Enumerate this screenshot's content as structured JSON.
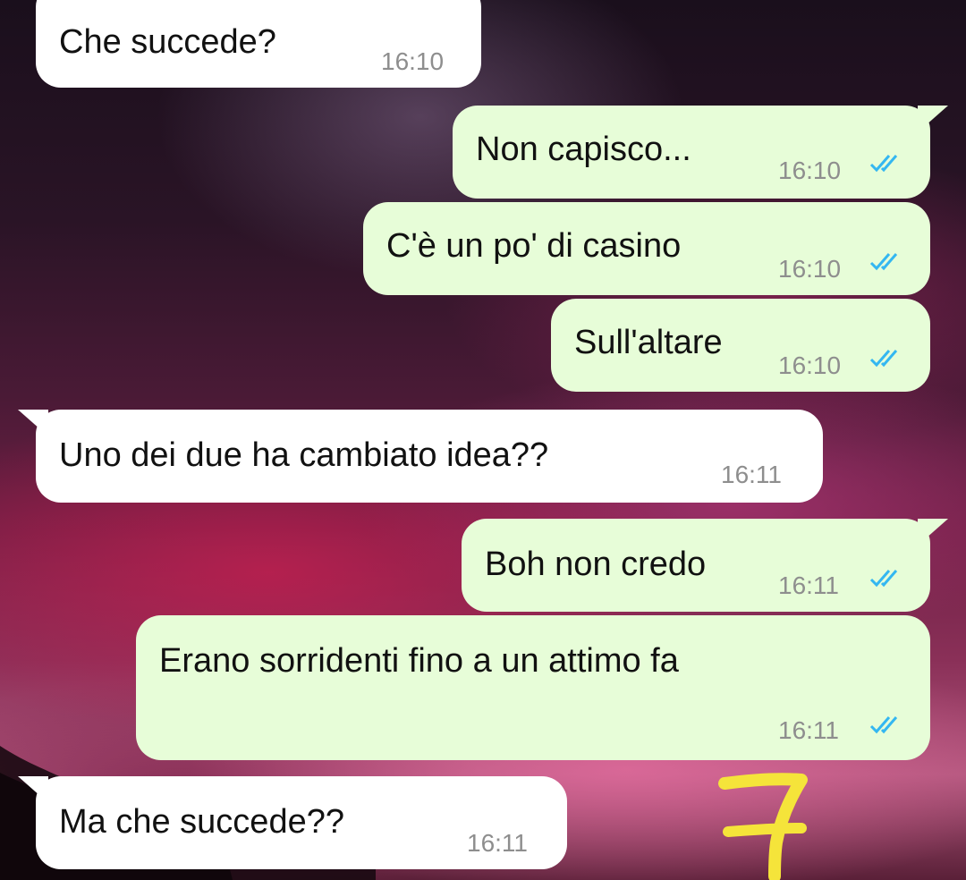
{
  "colors": {
    "incoming_bubble": "#ffffff",
    "outgoing_bubble": "#e7fdd8",
    "time_text": "#8e8e8e",
    "read_tick": "#34b7f1",
    "drawn_mark": "#f5e43a"
  },
  "messages": [
    {
      "direction": "incoming",
      "text": "Che succede?",
      "time": "16:10"
    },
    {
      "direction": "outgoing",
      "text": "Non capisco...",
      "time": "16:10",
      "status": "read"
    },
    {
      "direction": "outgoing",
      "text": "C'è un po' di casino",
      "time": "16:10",
      "status": "read"
    },
    {
      "direction": "outgoing",
      "text": "Sull'altare",
      "time": "16:10",
      "status": "read"
    },
    {
      "direction": "incoming",
      "text": "Uno dei due ha cambiato idea??",
      "time": "16:11"
    },
    {
      "direction": "outgoing",
      "text": "Boh non credo",
      "time": "16:11",
      "status": "read"
    },
    {
      "direction": "outgoing",
      "text": "Erano sorridenti fino a un attimo fa",
      "time": "16:11",
      "status": "read"
    },
    {
      "direction": "incoming",
      "text": "Ma che succede??",
      "time": "16:11"
    }
  ],
  "icons": {
    "read_receipt": "double-check-icon",
    "drawing": "handdrawn-number-7"
  }
}
